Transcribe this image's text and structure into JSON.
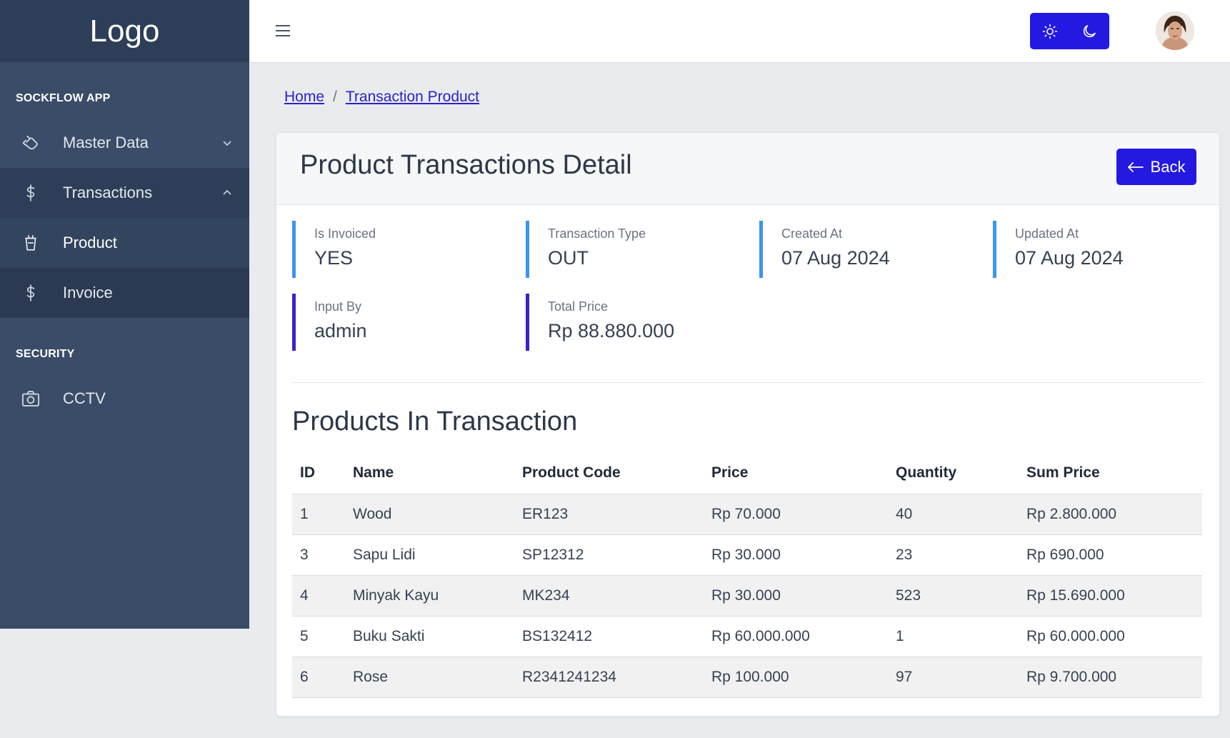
{
  "sidebar": {
    "logo": "Logo",
    "sections": [
      {
        "title": "SOCKFLOW APP"
      },
      {
        "title": "SECURITY"
      }
    ],
    "items": {
      "master_data": {
        "label": "Master Data",
        "icon": "hand-icon"
      },
      "transactions": {
        "label": "Transactions",
        "icon": "dollar-icon"
      },
      "product": {
        "label": "Product",
        "icon": "cup-icon"
      },
      "invoice": {
        "label": "Invoice",
        "icon": "dollar-icon"
      },
      "cctv": {
        "label": "CCTV",
        "icon": "camera-icon"
      }
    }
  },
  "topbar": {
    "theme_light_icon": "sun-icon",
    "theme_dark_icon": "moon-icon"
  },
  "breadcrumb": {
    "home": "Home",
    "separator": "/",
    "current": "Transaction Product"
  },
  "card": {
    "title": "Product Transactions Detail",
    "back_label": "Back",
    "stats": [
      {
        "label": "Is Invoiced",
        "value": "YES"
      },
      {
        "label": "Transaction Type",
        "value": "OUT"
      },
      {
        "label": "Created At",
        "value": "07 Aug 2024"
      },
      {
        "label": "Updated At",
        "value": "07 Aug 2024"
      },
      {
        "label": "Input By",
        "value": "admin"
      },
      {
        "label": "Total Price",
        "value": "Rp 88.880.000"
      }
    ],
    "products_heading": "Products In Transaction",
    "table": {
      "headers": [
        "ID",
        "Name",
        "Product Code",
        "Price",
        "Quantity",
        "Sum Price"
      ],
      "rows": [
        [
          "1",
          "Wood",
          "ER123",
          "Rp 70.000",
          "40",
          "Rp 2.800.000"
        ],
        [
          "3",
          "Sapu Lidi",
          "SP12312",
          "Rp 30.000",
          "23",
          "Rp 690.000"
        ],
        [
          "4",
          "Minyak Kayu",
          "MK234",
          "Rp 30.000",
          "523",
          "Rp 15.690.000"
        ],
        [
          "5",
          "Buku Sakti",
          "BS132412",
          "Rp 60.000.000",
          "1",
          "Rp 60.000.000"
        ],
        [
          "6",
          "Rose",
          "R2341241234",
          "Rp 100.000",
          "97",
          "Rp 9.700.000"
        ]
      ]
    }
  },
  "colors": {
    "sidebar": "#3a4c68",
    "primary": "#2419e0",
    "accent_blue": "#3b95ef",
    "accent_indigo": "#3b22cc"
  }
}
